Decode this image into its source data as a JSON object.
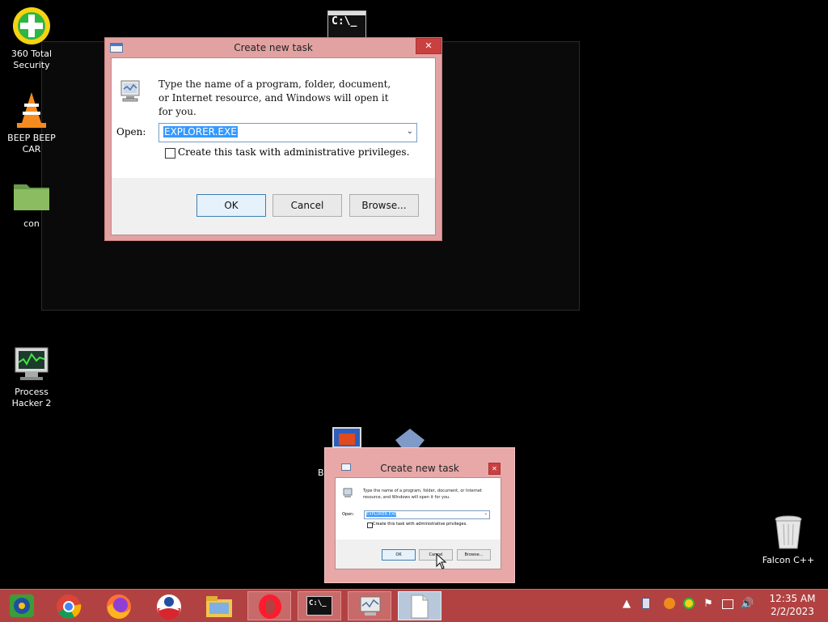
{
  "desktop": {
    "icons": [
      {
        "label": "360 Total Security",
        "icon": "360-security-icon"
      },
      {
        "label": "BEEP BEEP CAR",
        "icon": "vlc-cone-icon"
      },
      {
        "label": "con",
        "icon": "folder-icon"
      },
      {
        "label": "Process Hacker 2",
        "icon": "process-hacker-icon"
      },
      {
        "label": "Falcon C++",
        "icon": "recycle-bin-icon"
      }
    ],
    "cmd_icon_text": "C:\\_",
    "partial_label": "B"
  },
  "dialog_main": {
    "title": "Create new task",
    "close": "✕",
    "description": "Type the name of a program, folder, document, or Internet resource, and Windows will open it for you.",
    "open_label": "Open:",
    "open_value": "EXPLORER.EXE",
    "admin_checkbox_label": "Create this task with administrative privileges.",
    "admin_checked": false,
    "ok": "OK",
    "cancel": "Cancel",
    "browse": "Browse..."
  },
  "dialog_small": {
    "title": "Create new task",
    "close": "✕",
    "description": "Type the name of a program, folder, document, or Internet resource, and Windows will open it for you.",
    "open_label": "Open:",
    "open_value": "EXPLORER.EXE",
    "admin_checkbox_label": "Create this task with administrative privileges.",
    "ok": "OK",
    "cancel": "Cancel",
    "browse": "Browse..."
  },
  "taskbar": {
    "apps": [
      {
        "name": "media-player-icon"
      },
      {
        "name": "chrome-icon"
      },
      {
        "name": "firefox-icon"
      },
      {
        "name": "obama-logo-icon"
      },
      {
        "name": "file-explorer-icon"
      },
      {
        "name": "opera-icon"
      },
      {
        "name": "cmd-icon",
        "text": "C:\\_"
      },
      {
        "name": "task-manager-icon"
      },
      {
        "name": "blank-document-icon"
      }
    ],
    "time": "12:35 AM",
    "date": "2/2/2023",
    "tray": [
      "up-arrow-icon",
      "device-icon",
      "stop-icon",
      "360-tray-icon",
      "flag-icon",
      "network-icon",
      "volume-icon"
    ],
    "tray_up_arrow": "▲",
    "tray_flag": "⚑",
    "tray_volume": "🔊"
  },
  "colors": {
    "taskbar": "#b24242",
    "dialog_frame": "#e3a2a2",
    "selection": "#3399ff"
  }
}
